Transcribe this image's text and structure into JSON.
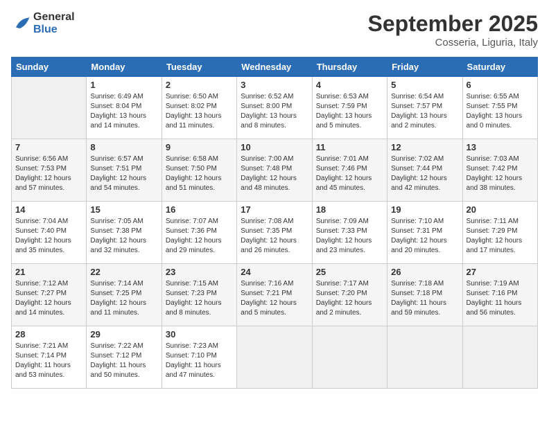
{
  "header": {
    "logo_line1": "General",
    "logo_line2": "Blue",
    "month": "September 2025",
    "location": "Cosseria, Liguria, Italy"
  },
  "weekdays": [
    "Sunday",
    "Monday",
    "Tuesday",
    "Wednesday",
    "Thursday",
    "Friday",
    "Saturday"
  ],
  "weeks": [
    [
      {
        "day": null
      },
      {
        "day": "1",
        "sunrise": "Sunrise: 6:49 AM",
        "sunset": "Sunset: 8:04 PM",
        "daylight": "Daylight: 13 hours and 14 minutes."
      },
      {
        "day": "2",
        "sunrise": "Sunrise: 6:50 AM",
        "sunset": "Sunset: 8:02 PM",
        "daylight": "Daylight: 13 hours and 11 minutes."
      },
      {
        "day": "3",
        "sunrise": "Sunrise: 6:52 AM",
        "sunset": "Sunset: 8:00 PM",
        "daylight": "Daylight: 13 hours and 8 minutes."
      },
      {
        "day": "4",
        "sunrise": "Sunrise: 6:53 AM",
        "sunset": "Sunset: 7:59 PM",
        "daylight": "Daylight: 13 hours and 5 minutes."
      },
      {
        "day": "5",
        "sunrise": "Sunrise: 6:54 AM",
        "sunset": "Sunset: 7:57 PM",
        "daylight": "Daylight: 13 hours and 2 minutes."
      },
      {
        "day": "6",
        "sunrise": "Sunrise: 6:55 AM",
        "sunset": "Sunset: 7:55 PM",
        "daylight": "Daylight: 13 hours and 0 minutes."
      }
    ],
    [
      {
        "day": "7",
        "sunrise": "Sunrise: 6:56 AM",
        "sunset": "Sunset: 7:53 PM",
        "daylight": "Daylight: 12 hours and 57 minutes."
      },
      {
        "day": "8",
        "sunrise": "Sunrise: 6:57 AM",
        "sunset": "Sunset: 7:51 PM",
        "daylight": "Daylight: 12 hours and 54 minutes."
      },
      {
        "day": "9",
        "sunrise": "Sunrise: 6:58 AM",
        "sunset": "Sunset: 7:50 PM",
        "daylight": "Daylight: 12 hours and 51 minutes."
      },
      {
        "day": "10",
        "sunrise": "Sunrise: 7:00 AM",
        "sunset": "Sunset: 7:48 PM",
        "daylight": "Daylight: 12 hours and 48 minutes."
      },
      {
        "day": "11",
        "sunrise": "Sunrise: 7:01 AM",
        "sunset": "Sunset: 7:46 PM",
        "daylight": "Daylight: 12 hours and 45 minutes."
      },
      {
        "day": "12",
        "sunrise": "Sunrise: 7:02 AM",
        "sunset": "Sunset: 7:44 PM",
        "daylight": "Daylight: 12 hours and 42 minutes."
      },
      {
        "day": "13",
        "sunrise": "Sunrise: 7:03 AM",
        "sunset": "Sunset: 7:42 PM",
        "daylight": "Daylight: 12 hours and 38 minutes."
      }
    ],
    [
      {
        "day": "14",
        "sunrise": "Sunrise: 7:04 AM",
        "sunset": "Sunset: 7:40 PM",
        "daylight": "Daylight: 12 hours and 35 minutes."
      },
      {
        "day": "15",
        "sunrise": "Sunrise: 7:05 AM",
        "sunset": "Sunset: 7:38 PM",
        "daylight": "Daylight: 12 hours and 32 minutes."
      },
      {
        "day": "16",
        "sunrise": "Sunrise: 7:07 AM",
        "sunset": "Sunset: 7:36 PM",
        "daylight": "Daylight: 12 hours and 29 minutes."
      },
      {
        "day": "17",
        "sunrise": "Sunrise: 7:08 AM",
        "sunset": "Sunset: 7:35 PM",
        "daylight": "Daylight: 12 hours and 26 minutes."
      },
      {
        "day": "18",
        "sunrise": "Sunrise: 7:09 AM",
        "sunset": "Sunset: 7:33 PM",
        "daylight": "Daylight: 12 hours and 23 minutes."
      },
      {
        "day": "19",
        "sunrise": "Sunrise: 7:10 AM",
        "sunset": "Sunset: 7:31 PM",
        "daylight": "Daylight: 12 hours and 20 minutes."
      },
      {
        "day": "20",
        "sunrise": "Sunrise: 7:11 AM",
        "sunset": "Sunset: 7:29 PM",
        "daylight": "Daylight: 12 hours and 17 minutes."
      }
    ],
    [
      {
        "day": "21",
        "sunrise": "Sunrise: 7:12 AM",
        "sunset": "Sunset: 7:27 PM",
        "daylight": "Daylight: 12 hours and 14 minutes."
      },
      {
        "day": "22",
        "sunrise": "Sunrise: 7:14 AM",
        "sunset": "Sunset: 7:25 PM",
        "daylight": "Daylight: 12 hours and 11 minutes."
      },
      {
        "day": "23",
        "sunrise": "Sunrise: 7:15 AM",
        "sunset": "Sunset: 7:23 PM",
        "daylight": "Daylight: 12 hours and 8 minutes."
      },
      {
        "day": "24",
        "sunrise": "Sunrise: 7:16 AM",
        "sunset": "Sunset: 7:21 PM",
        "daylight": "Daylight: 12 hours and 5 minutes."
      },
      {
        "day": "25",
        "sunrise": "Sunrise: 7:17 AM",
        "sunset": "Sunset: 7:20 PM",
        "daylight": "Daylight: 12 hours and 2 minutes."
      },
      {
        "day": "26",
        "sunrise": "Sunrise: 7:18 AM",
        "sunset": "Sunset: 7:18 PM",
        "daylight": "Daylight: 11 hours and 59 minutes."
      },
      {
        "day": "27",
        "sunrise": "Sunrise: 7:19 AM",
        "sunset": "Sunset: 7:16 PM",
        "daylight": "Daylight: 11 hours and 56 minutes."
      }
    ],
    [
      {
        "day": "28",
        "sunrise": "Sunrise: 7:21 AM",
        "sunset": "Sunset: 7:14 PM",
        "daylight": "Daylight: 11 hours and 53 minutes."
      },
      {
        "day": "29",
        "sunrise": "Sunrise: 7:22 AM",
        "sunset": "Sunset: 7:12 PM",
        "daylight": "Daylight: 11 hours and 50 minutes."
      },
      {
        "day": "30",
        "sunrise": "Sunrise: 7:23 AM",
        "sunset": "Sunset: 7:10 PM",
        "daylight": "Daylight: 11 hours and 47 minutes."
      },
      {
        "day": null
      },
      {
        "day": null
      },
      {
        "day": null
      },
      {
        "day": null
      }
    ]
  ]
}
